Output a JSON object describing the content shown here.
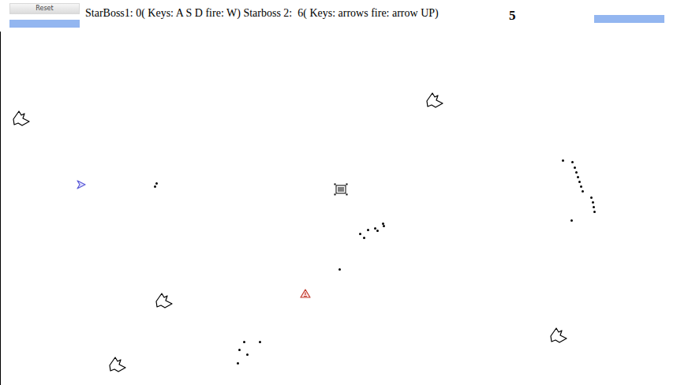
{
  "reset_button": {
    "label": "Reset"
  },
  "status_line": "StarBoss1: 0( Keys: A S D fire: W) Starboss 2:  6( Keys: arrows fire: arrow UP)",
  "round": "5",
  "health_bars": [
    {
      "level": 1
    },
    {
      "level": 1
    }
  ],
  "ships": [
    {
      "color": "#5b5bd6"
    },
    {
      "color": "#c0392b"
    }
  ],
  "objects": [
    {
      "kind": "asteroid"
    },
    {
      "kind": "asteroid"
    },
    {
      "kind": "asteroid"
    },
    {
      "kind": "asteroid"
    },
    {
      "kind": "asteroid"
    },
    {
      "kind": "powerup"
    },
    {
      "kind": "bullet"
    },
    {
      "kind": "bullet"
    },
    {
      "kind": "bullet"
    },
    {
      "kind": "bullet"
    },
    {
      "kind": "bullet"
    },
    {
      "kind": "bullet"
    },
    {
      "kind": "bullet"
    },
    {
      "kind": "bullet"
    },
    {
      "kind": "bullet"
    },
    {
      "kind": "bullet"
    },
    {
      "kind": "bullet"
    },
    {
      "kind": "bullet"
    },
    {
      "kind": "bullet"
    },
    {
      "kind": "bullet"
    },
    {
      "kind": "bullet"
    },
    {
      "kind": "bullet"
    },
    {
      "kind": "bullet"
    },
    {
      "kind": "bullet"
    },
    {
      "kind": "bullet"
    },
    {
      "kind": "bullet"
    },
    {
      "kind": "bullet"
    },
    {
      "kind": "bullet"
    },
    {
      "kind": "bullet"
    },
    {
      "kind": "bullet"
    },
    {
      "kind": "bullet"
    },
    {
      "kind": "bullet"
    },
    {
      "kind": "bullet"
    },
    {
      "kind": "bullet"
    }
  ]
}
